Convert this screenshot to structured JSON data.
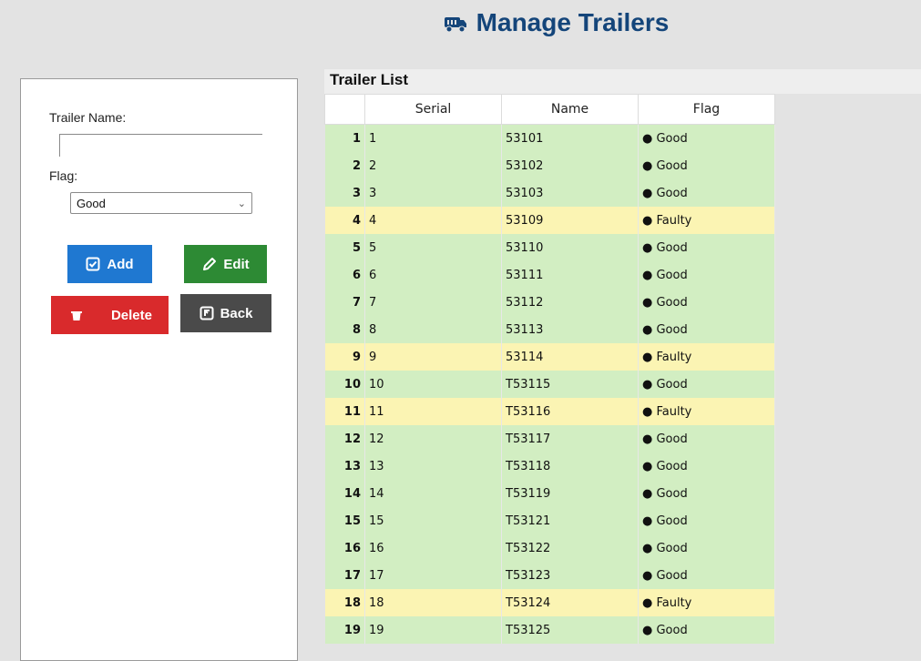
{
  "header": {
    "title": "Manage Trailers",
    "icon": "truck-icon",
    "color": "#14457a"
  },
  "form": {
    "name_label": "Trailer Name:",
    "name_value": "",
    "flag_label": "Flag:",
    "flag_value": "Good",
    "buttons": {
      "add": "Add",
      "edit": "Edit",
      "delete": "Delete",
      "back": "Back"
    }
  },
  "list": {
    "title": "Trailer List",
    "columns": [
      "",
      "Serial",
      "Name",
      "Flag"
    ],
    "rows": [
      {
        "idx": "1",
        "serial": "1",
        "name": "53101",
        "flag": "● Good",
        "status": "good"
      },
      {
        "idx": "2",
        "serial": "2",
        "name": "53102",
        "flag": "● Good",
        "status": "good"
      },
      {
        "idx": "3",
        "serial": "3",
        "name": "53103",
        "flag": "● Good",
        "status": "good"
      },
      {
        "idx": "4",
        "serial": "4",
        "name": "53109",
        "flag": "● Faulty",
        "status": "faulty"
      },
      {
        "idx": "5",
        "serial": "5",
        "name": "53110",
        "flag": "● Good",
        "status": "good"
      },
      {
        "idx": "6",
        "serial": "6",
        "name": "53111",
        "flag": "● Good",
        "status": "good"
      },
      {
        "idx": "7",
        "serial": "7",
        "name": "53112",
        "flag": "● Good",
        "status": "good"
      },
      {
        "idx": "8",
        "serial": "8",
        "name": "53113",
        "flag": "● Good",
        "status": "good"
      },
      {
        "idx": "9",
        "serial": "9",
        "name": "53114",
        "flag": "● Faulty",
        "status": "faulty"
      },
      {
        "idx": "10",
        "serial": "10",
        "name": "T53115",
        "flag": "● Good",
        "status": "good"
      },
      {
        "idx": "11",
        "serial": "11",
        "name": "T53116",
        "flag": "● Faulty",
        "status": "faulty"
      },
      {
        "idx": "12",
        "serial": "12",
        "name": "T53117",
        "flag": "● Good",
        "status": "good"
      },
      {
        "idx": "13",
        "serial": "13",
        "name": "T53118",
        "flag": "● Good",
        "status": "good"
      },
      {
        "idx": "14",
        "serial": "14",
        "name": "T53119",
        "flag": "● Good",
        "status": "good"
      },
      {
        "idx": "15",
        "serial": "15",
        "name": "T53121",
        "flag": "● Good",
        "status": "good"
      },
      {
        "idx": "16",
        "serial": "16",
        "name": "T53122",
        "flag": "● Good",
        "status": "good"
      },
      {
        "idx": "17",
        "serial": "17",
        "name": "T53123",
        "flag": "● Good",
        "status": "good"
      },
      {
        "idx": "18",
        "serial": "18",
        "name": "T53124",
        "flag": "● Faulty",
        "status": "faulty"
      },
      {
        "idx": "19",
        "serial": "19",
        "name": "T53125",
        "flag": "● Good",
        "status": "good"
      }
    ]
  },
  "colors": {
    "good_row": "#d2eec2",
    "faulty_row": "#fbf4b3",
    "add": "#1f78d1",
    "edit": "#2d8a34",
    "delete": "#d92a2c",
    "back": "#4a4a4a"
  }
}
